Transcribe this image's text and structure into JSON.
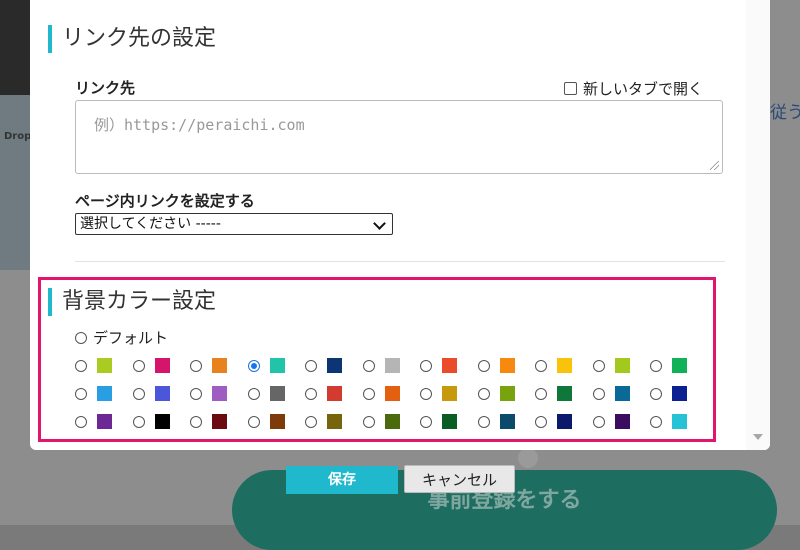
{
  "background": {
    "thumb_label": "Drop",
    "right_text": "従う",
    "big_button_label": "事前登録をする"
  },
  "link_section": {
    "heading": "リンク先の設定",
    "link_label": "リンク先",
    "new_tab_label": "新しいタブで開く",
    "new_tab_checked": false,
    "url_placeholder": "例）https://peraichi.com",
    "url_value": ""
  },
  "page_link": {
    "label": "ページ内リンクを設定する",
    "selected": "選択してください -----"
  },
  "bg_color_section": {
    "heading": "背景カラー設定",
    "default_label": "デフォルト",
    "default_checked": false,
    "selected_index": 3,
    "colors": [
      [
        "#aacc22",
        "#d4156b",
        "#e8821c",
        "#22c4a9",
        "#0c3673",
        "#b5b5b5",
        "#ec4b2b",
        "#f7890f",
        "#f9c30c",
        "#a3c91f",
        "#11b15a"
      ],
      [
        "#2a9ee3",
        "#4a57d8",
        "#9f5cc1",
        "#666666",
        "#d23b2f",
        "#e2600f",
        "#c79a0d",
        "#78a30f",
        "#10773a",
        "#0a6a97",
        "#0c2191"
      ],
      [
        "#6d2896",
        "#000000",
        "#6b0a10",
        "#7e3a0b",
        "#76650c",
        "#4b6a0d",
        "#0a5d25",
        "#0b4a6b",
        "#0b1a6b",
        "#3a0d61",
        "#26c2d6"
      ]
    ]
  },
  "footer": {
    "save_label": "保存",
    "cancel_label": "キャンセル"
  }
}
